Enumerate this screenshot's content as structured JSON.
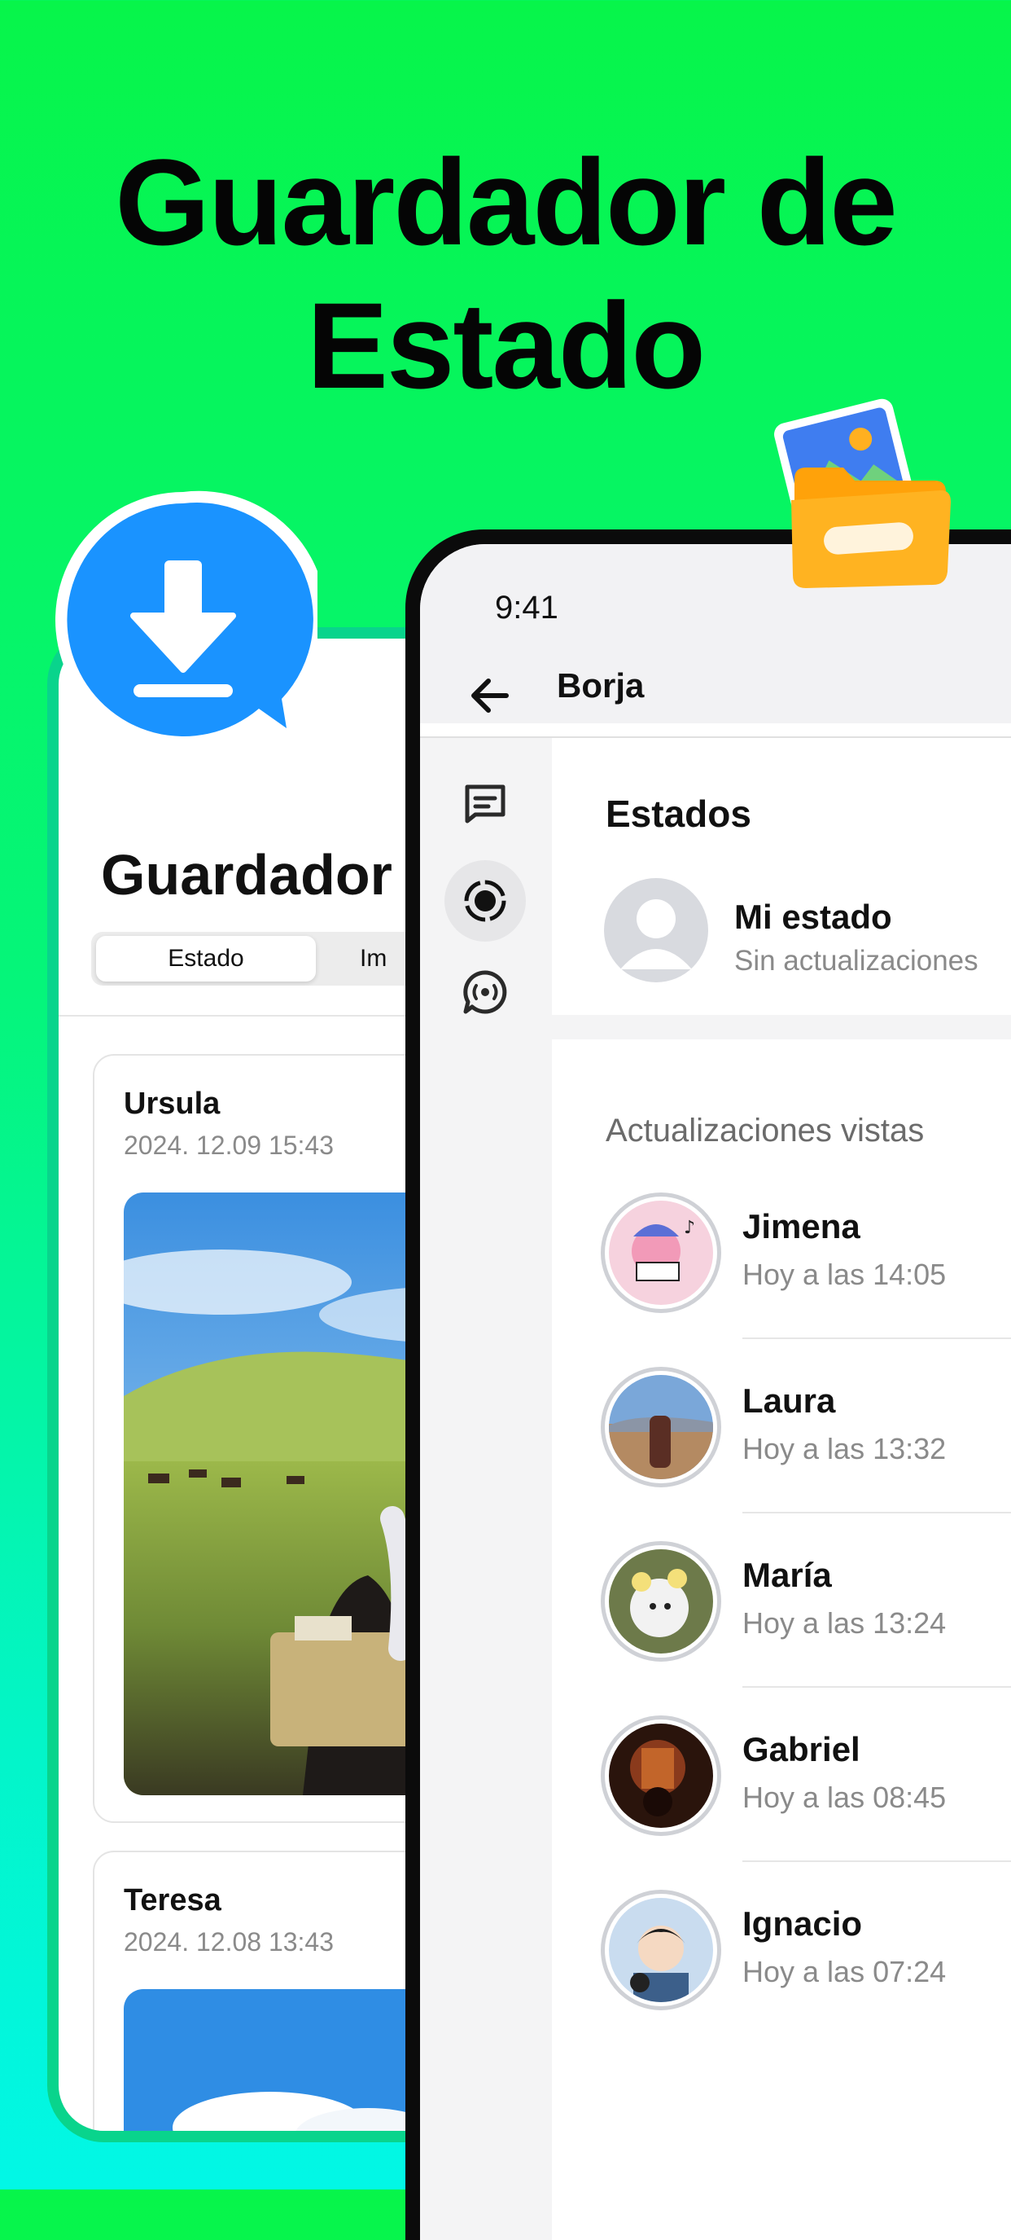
{
  "headline": {
    "line1": "Guardador de",
    "line2": "Estado"
  },
  "back_phone": {
    "app_title": "Guardador",
    "tabs": [
      {
        "label": "Estado",
        "active": true
      },
      {
        "label": "Im",
        "active": false
      }
    ],
    "cards": [
      {
        "name": "Ursula",
        "date": "2024. 12.09 15:43"
      },
      {
        "name": "Teresa",
        "date": "2024. 12.08 13:43"
      }
    ]
  },
  "front_phone": {
    "status_time": "9:41",
    "nav_title": "Borja",
    "section_title": "Estados",
    "my_status": {
      "name": "Mi estado",
      "subtitle": "Sin actualizaciones"
    },
    "viewed_header": "Actualizaciones vistas",
    "contacts": [
      {
        "name": "Jimena",
        "time": "Hoy a las 14:05"
      },
      {
        "name": "Laura",
        "time": "Hoy a las 13:32"
      },
      {
        "name": "María",
        "time": "Hoy a las 13:24"
      },
      {
        "name": "Gabriel",
        "time": "Hoy a las 08:45"
      },
      {
        "name": "Ignacio",
        "time": "Hoy a las 07:24"
      }
    ],
    "rail_icons": [
      "chats-icon",
      "status-icon",
      "communities-icon"
    ]
  },
  "colors": {
    "accent_blue": "#1a93ff",
    "bg_green": "#07f54a",
    "bg_cyan": "#02f7e6"
  }
}
